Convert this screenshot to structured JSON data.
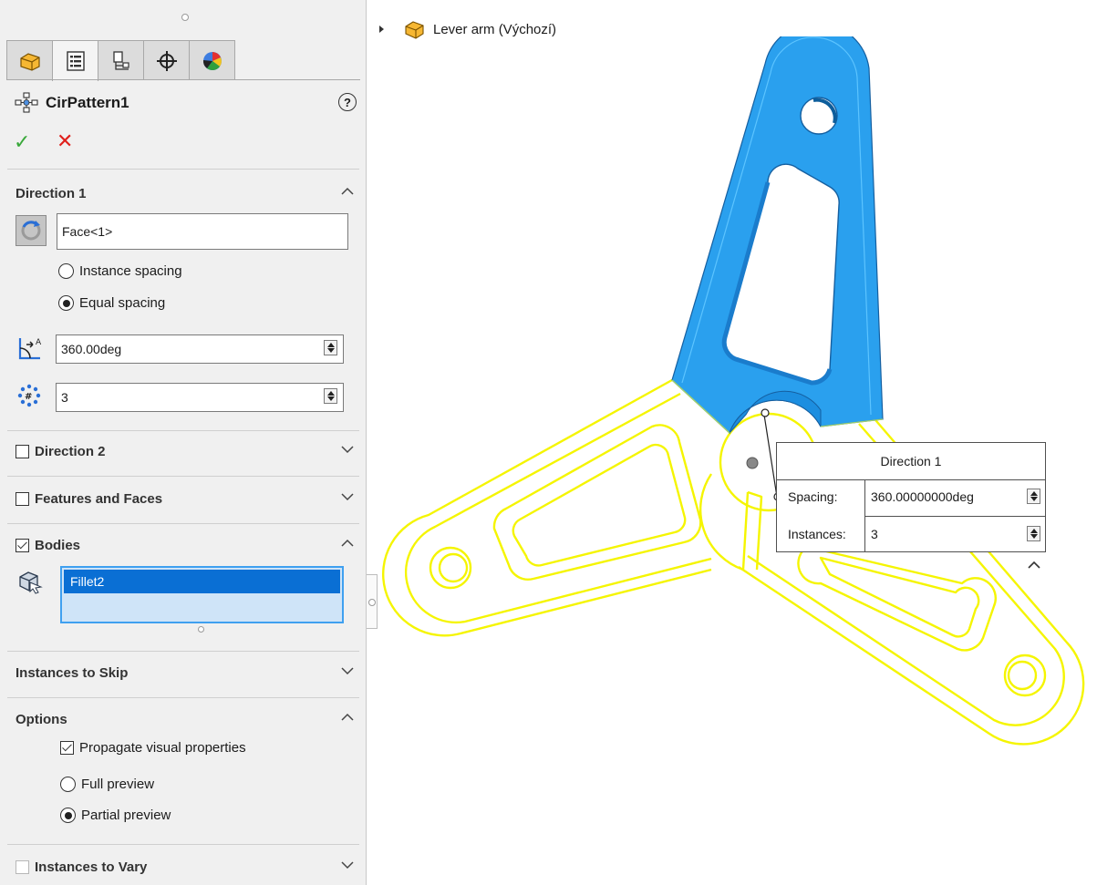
{
  "property_manager": {
    "title": "CirPattern1",
    "help_glyph": "?",
    "ok_glyph": "✓",
    "cancel_glyph": "✕",
    "tabs": [
      {
        "icon": "feature-manager-icon"
      },
      {
        "icon": "property-manager-icon"
      },
      {
        "icon": "configuration-manager-icon"
      },
      {
        "icon": "dimxpert-manager-icon"
      },
      {
        "icon": "display-manager-icon"
      }
    ],
    "direction1": {
      "label": "Direction 1",
      "axis_value": "Face<1>",
      "instance_spacing_label": "Instance spacing",
      "equal_spacing_label": "Equal spacing",
      "selected_spacing": "Equal spacing",
      "angle_value": "360.00deg",
      "instances_value": "3"
    },
    "direction2": {
      "label": "Direction 2",
      "checked": false
    },
    "features_and_faces": {
      "label": "Features and Faces",
      "checked": false
    },
    "bodies": {
      "label": "Bodies",
      "checked": true,
      "items": [
        "Fillet2"
      ]
    },
    "instances_to_skip": {
      "label": "Instances to Skip"
    },
    "options": {
      "label": "Options",
      "propagate_label": "Propagate visual properties",
      "propagate_checked": true,
      "full_preview_label": "Full preview",
      "partial_preview_label": "Partial preview",
      "selected_preview": "Partial preview"
    },
    "instances_to_vary": {
      "label": "Instances to Vary",
      "checked": false
    }
  },
  "viewport": {
    "tree_label": "Lever arm  (Výchozí)",
    "colors": {
      "selected_face": "#2aa0ee",
      "preview_outline": "#f5f500"
    },
    "callout": {
      "title": "Direction 1",
      "spacing_label": "Spacing:",
      "spacing_value": "360.00000000deg",
      "instances_label": "Instances:",
      "instances_value": "3"
    }
  }
}
